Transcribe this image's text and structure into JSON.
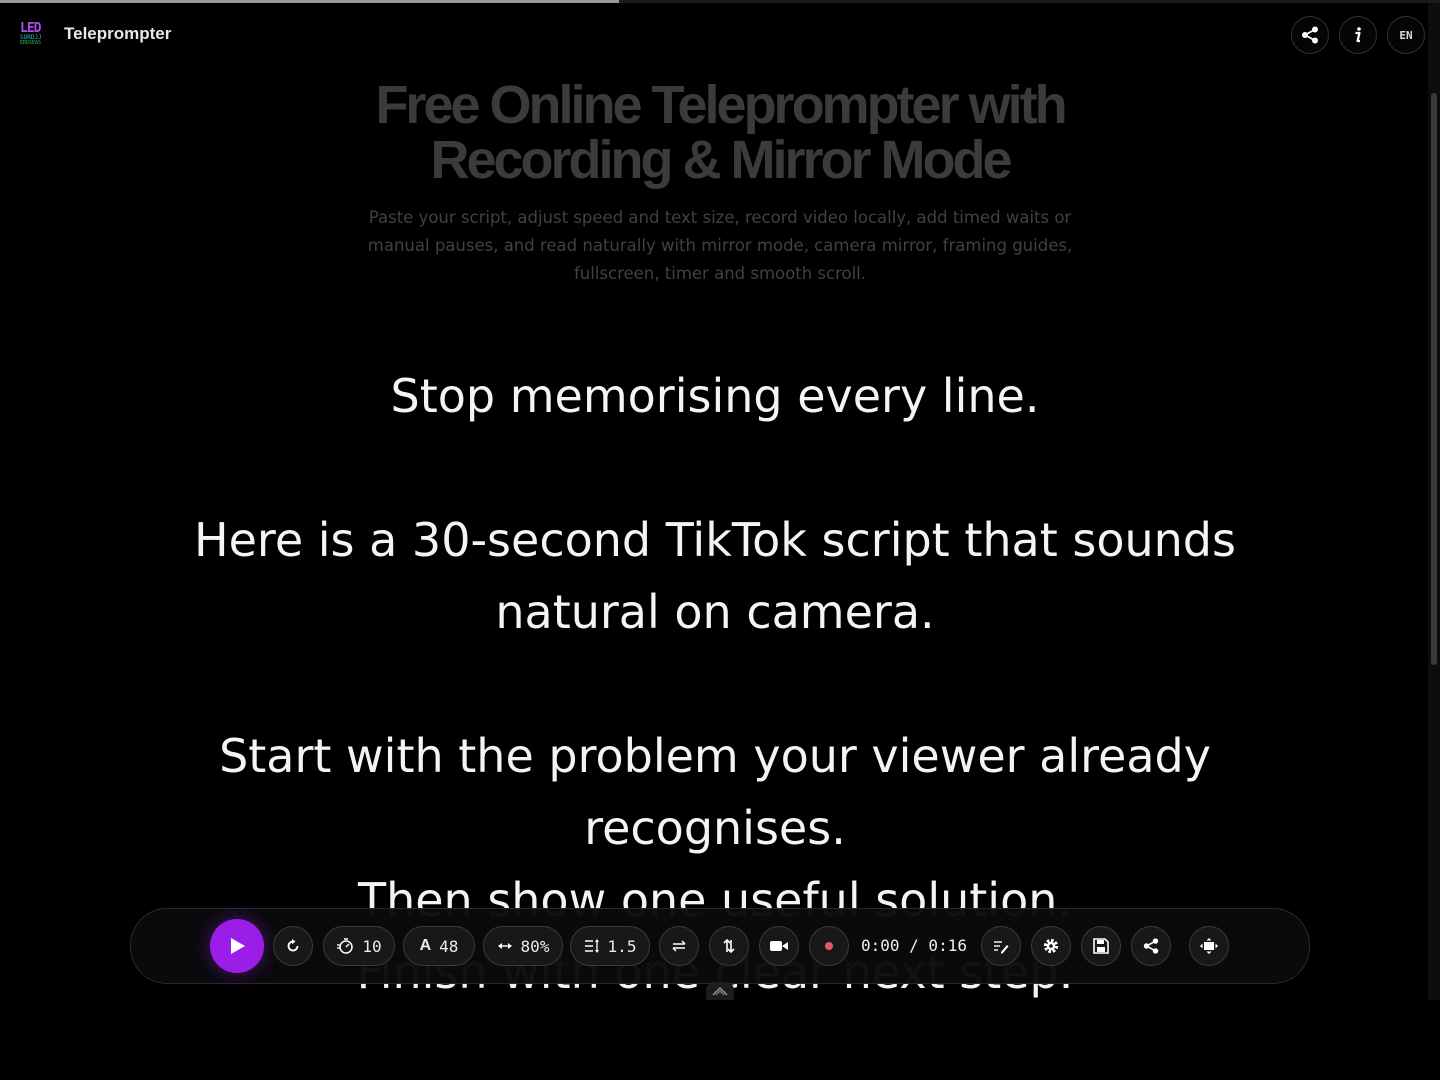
{
  "app": {
    "title": "Teleprompter",
    "logo": {
      "line1": "LED",
      "line2": "SORDJJ",
      "line3": "ERDSEAS"
    },
    "language": "EN"
  },
  "header_icons": [
    "share-icon",
    "info-icon"
  ],
  "hero": {
    "heading": "Free Online Teleprompter with Recording & Mirror Mode",
    "description": "Paste your script, adjust speed and text size, record video locally, add timed waits or manual pauses, and read naturally with mirror mode, camera mirror, framing guides, fullscreen, timer and smooth scroll."
  },
  "script": {
    "paragraphs": [
      "Stop memorising every line.",
      "Here is a 30-second TikTok script that sounds natural on camera.",
      "Start with the problem your viewer already recognises.",
      "Then show one useful solution.",
      "Finish with one clear next step."
    ]
  },
  "controls": {
    "speed": "10",
    "font_size": "48",
    "width": "80%",
    "line_height": "1.5",
    "timer": "0:00 / 0:16"
  },
  "reading_progress": 0.43,
  "colors": {
    "accent": "#9a1ee8",
    "record": "#e0566f",
    "background": "#000000",
    "text": "#f4f4f4"
  }
}
